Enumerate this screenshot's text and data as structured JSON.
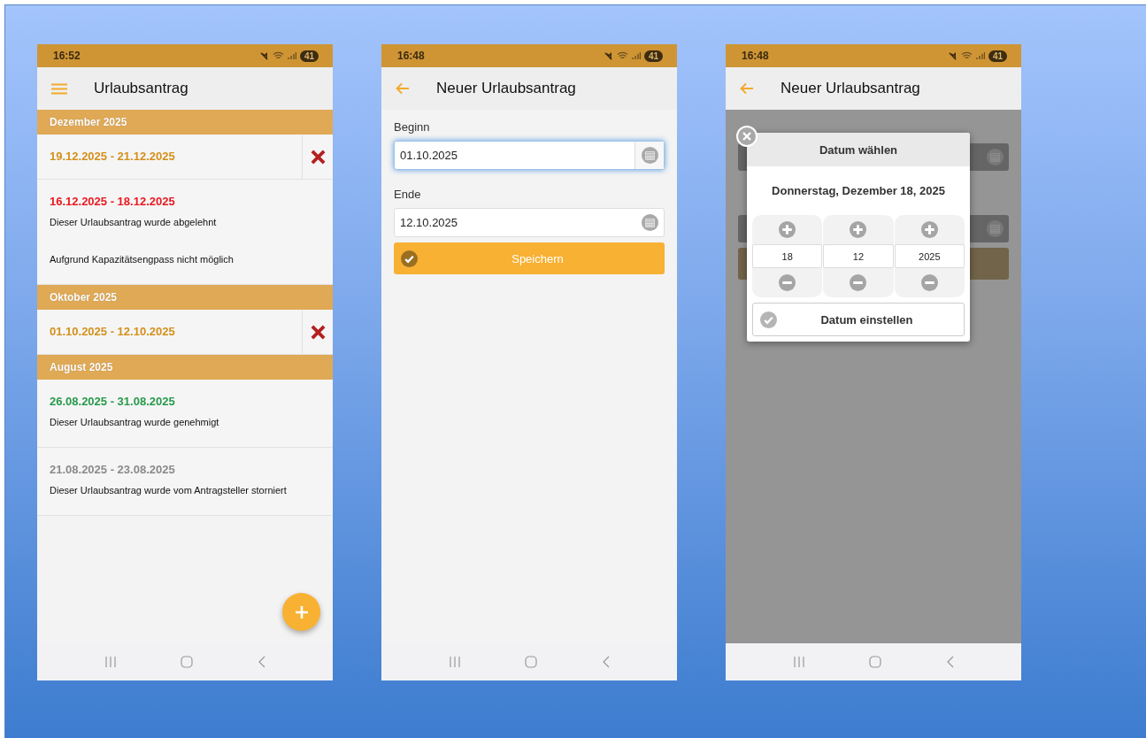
{
  "list_screen": {
    "status_bar": {
      "time": "16:52",
      "battery": "41"
    },
    "title": "Urlaubsantrag",
    "sections": [
      {
        "title": "Dezember 2025",
        "items": [
          {
            "dates": "19.12.2025 - 21.12.2025",
            "color": "#d4901c",
            "deletable": true
          },
          {
            "dates": "16.12.2025 - 18.12.2025",
            "color": "#e8191f",
            "deletable": false,
            "lines": [
              "Dieser Urlaubsantrag wurde abgelehnt",
              "Aufgrund Kapazitätsengpass nicht möglich"
            ]
          }
        ]
      },
      {
        "title": "Oktober 2025",
        "items": [
          {
            "dates": "01.10.2025 - 12.10.2025",
            "color": "#d4901c",
            "deletable": true
          }
        ]
      },
      {
        "title": "August 2025",
        "items": [
          {
            "dates": "26.08.2025 - 31.08.2025",
            "color": "#27994a",
            "deletable": false,
            "lines": [
              "Dieser Urlaubsantrag wurde genehmigt"
            ]
          },
          {
            "dates": "21.08.2025 - 23.08.2025",
            "color": "#8a8a8a",
            "deletable": false,
            "lines": [
              "Dieser Urlaubsantrag wurde vom Antragsteller storniert"
            ]
          }
        ]
      }
    ]
  },
  "form_screen": {
    "status_bar": {
      "time": "16:48",
      "battery": "41"
    },
    "title": "Neuer Urlaubsantrag",
    "fields": [
      {
        "label": "Beginn",
        "value": "01.10.2025",
        "focused": true
      },
      {
        "label": "Ende",
        "value": "12.10.2025",
        "focused": false
      }
    ],
    "save_button": "Speichern"
  },
  "picker_screen": {
    "status_bar": {
      "time": "16:48",
      "battery": "41"
    },
    "title": "Neuer Urlaubsantrag",
    "dialog": {
      "title": "Datum wählen",
      "date_text": "Donnerstag, Dezember 18, 2025",
      "columns": [
        "18",
        "12",
        "2025"
      ],
      "confirm_button": "Datum einstellen"
    }
  }
}
